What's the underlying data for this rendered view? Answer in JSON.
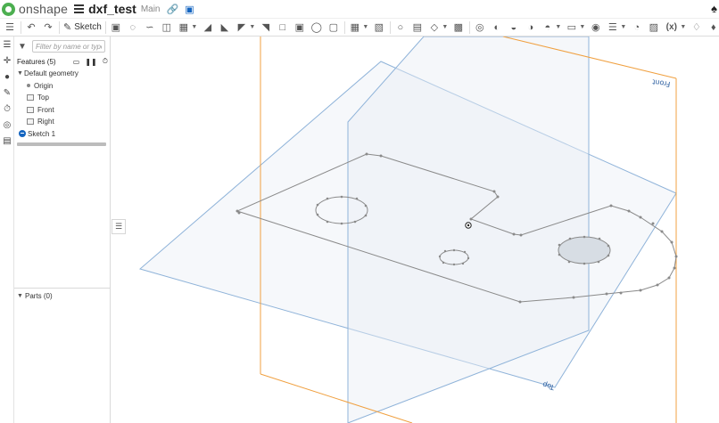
{
  "app": {
    "brand": "onshape",
    "document_title": "dxf_test",
    "workspace": "Main"
  },
  "toolbar": {
    "sketch_label": "Sketch",
    "variable_label": "(x)"
  },
  "panel": {
    "filter_placeholder": "Filter by name or type",
    "features_label": "Features (5)",
    "default_geometry_label": "Default geometry",
    "items": [
      {
        "label": "Origin",
        "kind": "point"
      },
      {
        "label": "Top",
        "kind": "plane"
      },
      {
        "label": "Front",
        "kind": "plane"
      },
      {
        "label": "Right",
        "kind": "plane"
      },
      {
        "label": "Sketch 1",
        "kind": "sketch"
      }
    ],
    "parts_label": "Parts (0)"
  },
  "viewport": {
    "plane_labels": {
      "front": "Front",
      "top": "Top"
    }
  },
  "colors": {
    "top_plane": "#8fb3d9",
    "front_plane_edge": "#f0a040",
    "sketch_line": "#8a8a8a",
    "filled_circle": "#d7dde4",
    "accent_blue": "#1565c0",
    "logo_green": "#4caf50"
  },
  "icons": {
    "undo": "undo-icon",
    "redo": "redo-icon",
    "filter": "funnel-icon",
    "notifications": "bell-icon",
    "feature_list_toggle": "list-icon"
  }
}
